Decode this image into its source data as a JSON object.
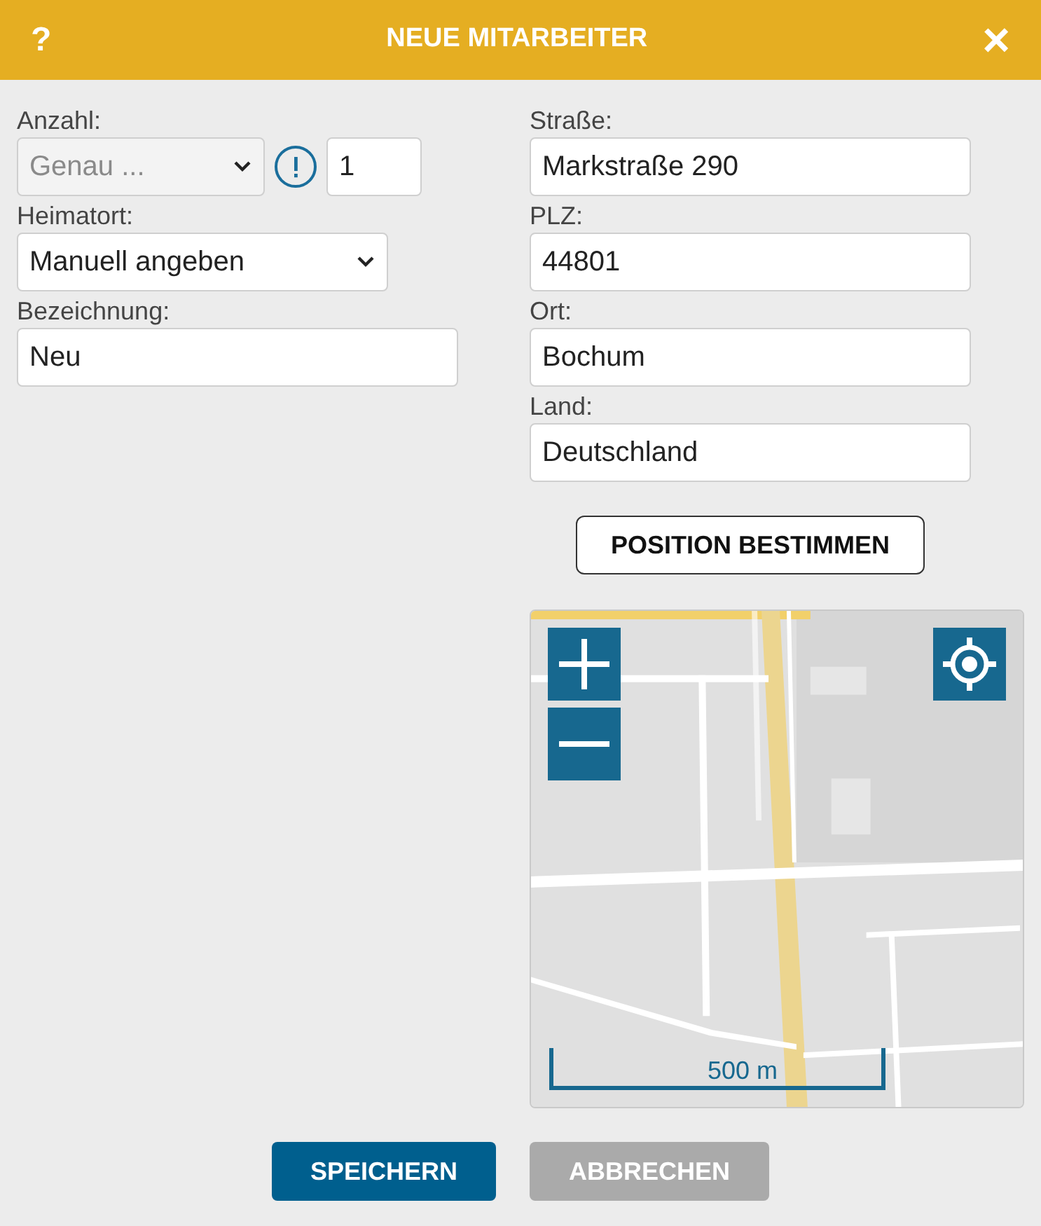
{
  "dialog": {
    "help": "?",
    "title": "NEUE MITARBEITER",
    "close": "×"
  },
  "left": {
    "anzahl": {
      "label": "Anzahl:",
      "select_value": "Genau ...",
      "disabled": true,
      "count": "1"
    },
    "heimatort": {
      "label": "Heimatort:",
      "select_value": "Manuell angeben",
      "disabled": false
    },
    "bezeichnung": {
      "label": "Bezeichnung:",
      "value": "Neu"
    }
  },
  "address": [
    {
      "label": "Straße:",
      "value": "Markstraße 290"
    },
    {
      "label": "PLZ:",
      "value": "44801"
    },
    {
      "label": "Ort:",
      "value": "Bochum"
    },
    {
      "label": "Land:",
      "value": "Deutschland"
    }
  ],
  "locate_button": "POSITION BESTIMMEN",
  "map": {
    "kind": "picture",
    "scale": "500 m"
  },
  "buttons": [
    {
      "label": "SPEICHERN",
      "kind": "primary"
    },
    {
      "label": "ABBRECHEN",
      "kind": "secondary"
    }
  ]
}
